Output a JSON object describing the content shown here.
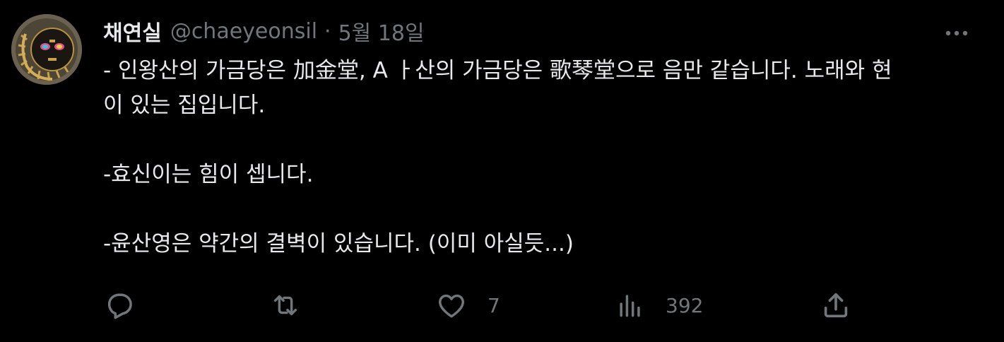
{
  "author": {
    "display_name": "채연실",
    "handle": "@chaeyeonsil",
    "separator": "·",
    "date": "5월 18일"
  },
  "tweet": {
    "lines": [
      "- 인왕산의 가금당은 加金堂, A ㅏ산의 가금당은 歌琴堂으로 음만 같습니다. 노래와 현",
      "이 있는 집입니다.",
      "",
      "-효신이는 힘이 셉니다.",
      "",
      "-윤산영은 약간의 결벽이 있습니다. (이미 아실듯...)"
    ]
  },
  "actions": {
    "reply": {
      "icon": "reply-icon",
      "count": ""
    },
    "retweet": {
      "icon": "retweet-icon",
      "count": ""
    },
    "like": {
      "icon": "heart-icon",
      "count": "7"
    },
    "views": {
      "icon": "analytics-icon",
      "count": "392"
    },
    "share": {
      "icon": "share-icon"
    }
  },
  "colors": {
    "background": "#000000",
    "text": "#e7e9ea",
    "secondary": "#71767b"
  }
}
